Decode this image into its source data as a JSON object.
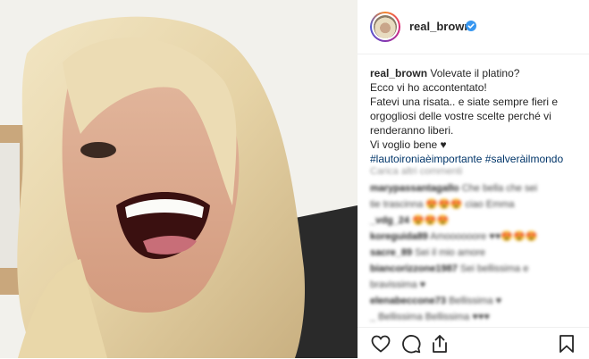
{
  "post": {
    "username": "real_brown",
    "verified": true,
    "caption": {
      "username": "real_brown",
      "lines": [
        "Volevate il platino?",
        "Ecco vi ho accontentato!",
        "Fatevi una risata.. e siate sempre fieri e",
        "orgogliosi delle vostre scelte perché vi",
        "renderanno liberi.",
        "Vi voglio bene ♥"
      ],
      "hashtags": [
        "#lautoironiaèimportante",
        "#salveràilmondo"
      ]
    },
    "load_more": "Carica altri commenti",
    "comments": [
      {
        "user": "marypassantagallo",
        "text": "Che bella che sei"
      },
      {
        "user": "",
        "text": "tie trascinna 😍😍😍 ciao Emma"
      },
      {
        "user": "_vdg_24",
        "text": "😍😍😍"
      },
      {
        "user": "koreguida89",
        "text": "Amoooooore ♥♥😍😍😍"
      },
      {
        "user": "sacre_89",
        "text": "Sei il mio amore"
      },
      {
        "user": "biancorizzone1987",
        "text": "Sei bellissima e"
      },
      {
        "user": "",
        "text": "bravissima ♥"
      },
      {
        "user": "elenabeccone73",
        "text": "Bellissima ♥"
      },
      {
        "user": "_",
        "text": "Bellissima Bellissima ♥♥♥"
      }
    ]
  },
  "icons": {
    "like": "heart-icon",
    "comment": "comment-icon",
    "share": "share-icon",
    "save": "bookmark-icon",
    "verified": "verified-badge-icon"
  },
  "colors": {
    "verified": "#3897f0",
    "hashtag": "#003569",
    "text": "#262626"
  }
}
